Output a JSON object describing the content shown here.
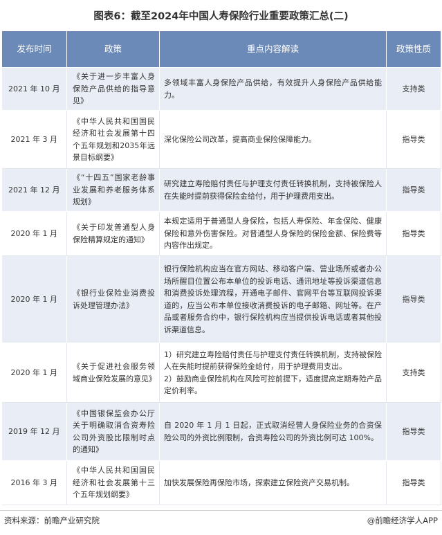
{
  "title": "图表6：截至2024年中国人寿保险行业重要政策汇总(二)",
  "headers": {
    "date": "发布时间",
    "policy": "政策",
    "content": "重点内容解读",
    "nature": "政策性质"
  },
  "rows": [
    {
      "date": "2021 年 10 月",
      "policy": "《关于进一步丰富人身保险产品供给的指导意见》",
      "content": [
        "多领域丰富人身保险产品供给，有效提升人身保险产品供给能力。"
      ],
      "nature": "支持类"
    },
    {
      "date": "2021 年 3 月",
      "policy": "《中华人民共和国国民经济和社会发展第十四个五年规划和2035年远景目标纲要》",
      "content": [
        "深化保险公司改革，提高商业保险保障能力。"
      ],
      "nature": "指导类"
    },
    {
      "date": "2021 年 12 月",
      "policy": "《“十四五”国家老龄事业发展和养老服务体系规划》",
      "content": [
        "研究建立寿险赔付责任与护理支付责任转换机制，支持被保险人在失能时提前获得保险金给付，用于护理费用支出。"
      ],
      "nature": "指导类"
    },
    {
      "date": "2020 年 1 月",
      "policy": "《关于印发普通型人身保险精算规定的通知》",
      "content": [
        "本规定适用于普通型人身保险，包括人寿保险、年金保险、健康保险和意外伤害保险。对普通型人身保险的保险金额、保险费等内容作出规定。"
      ],
      "nature": "指导类"
    },
    {
      "date": "2020 年 1 月",
      "policy": "《银行业保险业消费投诉处理管理办法》",
      "content": [
        "银行保险机构应当在官方网站、移动客户端、营业场所或者办公场所醒目位置公布本单位的投诉电话、通讯地址等投诉渠道信息和消费投诉处理流程，开通电子邮件、官网平台等互联网投诉渠道的，应当公布本单位接收消费投诉的电子邮箱、网址等。在产品或者服务合约中，银行保险机构应当提供投诉电话或者其他投诉渠道信息。"
      ],
      "nature": "指导类"
    },
    {
      "date": "2020 年 1 月",
      "policy": "《关于促进社会服务领域商业保险发展的意见》",
      "content": [
        "1）研究建立寿险赔付责任与护理支付责任转换机制，支持被保险人在失能时提前获得保险金给付，用于护理费用支出。",
        "2）鼓励商业保险机构在风险可控前提下，适度提高定期寿险产品定价利率。"
      ],
      "nature": "支持类"
    },
    {
      "date": "2019 年 12 月",
      "policy": "《中国银保监会办公厅关于明确取消合资寿险公司外资股比限制时点的通知》",
      "content": [
        "自 2020 年 1 月 1 日起，正式取消经营人身保险业务的合资保险公司的外资比例限制，合资寿险公司的外资比例可达 100%。"
      ],
      "nature": "指导类"
    },
    {
      "date": "2016 年 3 月",
      "policy": "《中华人民共和国国民经济和社会发展第十三个五年规划纲要》",
      "content": [
        "加快发展保险再保险市场，探索建立保险资产交易机制。"
      ],
      "nature": "指导类"
    }
  ],
  "footer": {
    "source": "资料来源：前瞻产业研究院",
    "brand": "@前瞻经济学人APP"
  }
}
